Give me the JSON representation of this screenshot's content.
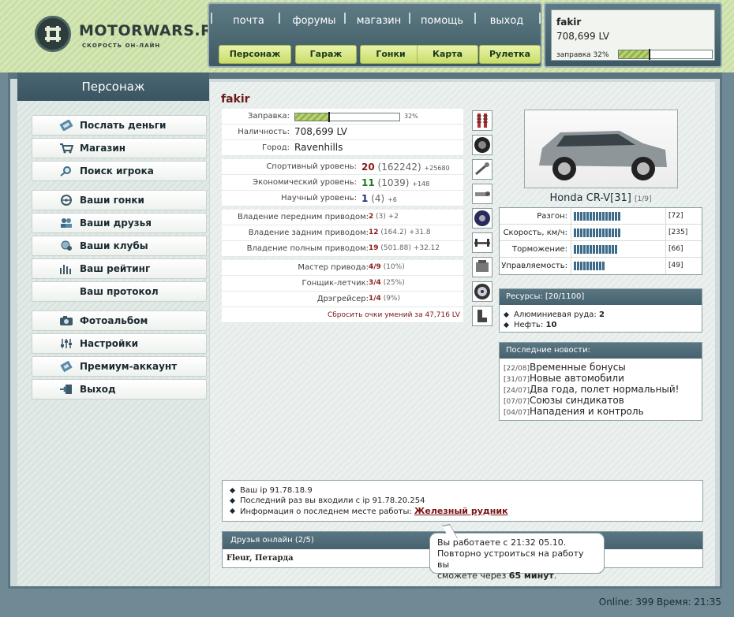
{
  "header": {
    "logo_title": "MOTORWARS.RU",
    "logo_subtitle": "СКОРОСТЬ ОН-ЛАЙН",
    "nav_links": [
      "почта",
      "форумы",
      "магазин",
      "помощь",
      "выход"
    ],
    "nav_buttons": [
      "Персонаж",
      "Гараж",
      "Гонки",
      "Карта",
      "Рулетка"
    ]
  },
  "user": {
    "name": "fakir",
    "money": "708,699 LV",
    "fuel_label": "заправка 32%",
    "fuel_percent": 32
  },
  "sidebar": {
    "title": "Персонаж",
    "items": [
      {
        "label": "Послать деньги",
        "icon": "money-icon"
      },
      {
        "label": "Магазин",
        "icon": "shop-icon"
      },
      {
        "label": "Поиск игрока",
        "icon": "search-icon"
      },
      {
        "label": "Ваши гонки",
        "icon": "steering-wheel-icon"
      },
      {
        "label": "Ваши друзья",
        "icon": "friends-icon"
      },
      {
        "label": "Ваши клубы",
        "icon": "clubs-icon"
      },
      {
        "label": "Ваш рейтинг",
        "icon": "rating-icon"
      },
      {
        "label": "Ваш протокол",
        "icon": ""
      },
      {
        "label": "Фотоальбом",
        "icon": "photo-icon"
      },
      {
        "label": "Настройки",
        "icon": "settings-icon"
      },
      {
        "label": "Премиум-аккаунт",
        "icon": "premium-icon"
      },
      {
        "label": "Выход",
        "icon": "exit-icon"
      }
    ]
  },
  "character": {
    "name": "fakir",
    "fuel": {
      "label": "Заправка:",
      "value": "32%",
      "percent": 32
    },
    "cash": {
      "label": "Наличность:",
      "value": "708,699 LV"
    },
    "city": {
      "label": "Город:",
      "value": "Ravenhills"
    },
    "levels": [
      {
        "label": "Спортивный уровень:",
        "main": "20",
        "points": "(162242)",
        "next": "+25680"
      },
      {
        "label": "Экономический уровень:",
        "main": "11",
        "points": "(1039)",
        "next": "+148"
      },
      {
        "label": "Научный уровень:",
        "main": "1",
        "points": "(4)",
        "next": "+6"
      }
    ],
    "drives": [
      {
        "label": "Владение передним приводом:",
        "main": "2",
        "points": "(3)",
        "next": "+2"
      },
      {
        "label": "Владение задним приводом:",
        "main": "12",
        "points": "(164.2)",
        "next": "+31.8"
      },
      {
        "label": "Владение полным приводом:",
        "main": "19",
        "points": "(501.88)",
        "next": "+32.12"
      }
    ],
    "skills": [
      {
        "label": "Мастер привода:",
        "main": "4/9",
        "extra": "(10%)"
      },
      {
        "label": "Гонщик-летчик:",
        "main": "3/4",
        "extra": "(25%)"
      },
      {
        "label": "Дрэгрейсер:",
        "main": "1/4",
        "extra": "(9%)"
      }
    ],
    "reset_link": "Сбросить очки умений за 47,716 LV"
  },
  "parts_icons": [
    "shocks-icon",
    "tire-icon",
    "wrench-icon",
    "exhaust-icon",
    "disc-icon",
    "axle-icon",
    "engine-icon",
    "wheel-icon",
    "seat-icon"
  ],
  "car": {
    "name": "Honda CR-V[31]",
    "level": "[1/9]",
    "stats": [
      {
        "label": "Разгон:",
        "value": "[72]",
        "bars": 15
      },
      {
        "label": "Скорость, км/ч:",
        "value": "[235]",
        "bars": 15
      },
      {
        "label": "Торможение:",
        "value": "[66]",
        "bars": 14
      },
      {
        "label": "Управляемость:",
        "value": "[49]",
        "bars": 10
      }
    ]
  },
  "resources": {
    "title": "Ресурсы: [20/1100]",
    "items": [
      {
        "label": "Алюминиевая руда:",
        "value": "2"
      },
      {
        "label": "Нефть:",
        "value": "10"
      }
    ]
  },
  "news": {
    "title": "Последние новости:",
    "items": [
      {
        "date": "[22/08]",
        "text": "Временные бонусы"
      },
      {
        "date": "[31/07]",
        "text": "Новые автомобили"
      },
      {
        "date": "[24/07]",
        "text": "Два года, полет нормальный!"
      },
      {
        "date": "[07/07]",
        "text": "Союзы синдикатов"
      },
      {
        "date": "[04/07]",
        "text": "Нападения и контроль"
      }
    ]
  },
  "info": {
    "ip_line": "Ваш ip 91.78.18.9",
    "last_ip_line": "Последний раз вы входили с ip 91.78.20.254",
    "work_line": "Информация о последнем месте работы:",
    "work_link": "Железный рудник"
  },
  "friends": {
    "title": "Друзья онлайн (2/5)",
    "list": "Fleur, Петарда"
  },
  "tooltip": {
    "line1": "Вы работаете с 21:32 05.10.",
    "line2": "Повторно устроиться на работу вы",
    "line3a": "сможете через",
    "line3b": "65 минут",
    "line3c": "."
  },
  "footer": {
    "online": "Online: 399",
    "time": "Время: 21:35"
  }
}
